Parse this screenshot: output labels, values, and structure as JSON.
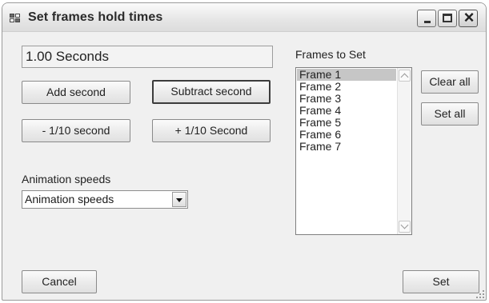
{
  "window": {
    "title": "Set frames hold times"
  },
  "hold_time": {
    "value": "1.00 Seconds"
  },
  "buttons": {
    "add_second": "Add second",
    "subtract_second": "Subtract second",
    "minus_tenth": "- 1/10 second",
    "plus_tenth": "+ 1/10 Second",
    "clear_all": "Clear all",
    "set_all": "Set all",
    "cancel": "Cancel",
    "set": "Set"
  },
  "animation_speeds": {
    "label": "Animation speeds",
    "selected": "Animation speeds"
  },
  "frames": {
    "label": "Frames to Set",
    "items": [
      "Frame 1",
      "Frame 2",
      "Frame 3",
      "Frame 4",
      "Frame 5",
      "Frame 6",
      "Frame 7"
    ],
    "selected_index": 0
  }
}
